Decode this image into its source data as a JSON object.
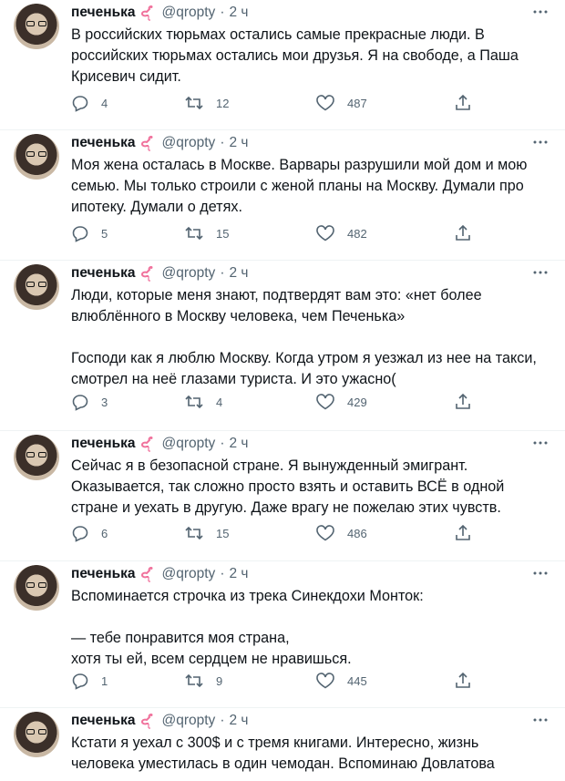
{
  "tweets": [
    {
      "author": "печенька",
      "handle": "@qropty",
      "time": "2 ч",
      "text": "В российских тюрьмах остались самые прекрасные люди. В российских тюрьмах остались мои друзья. Я на свободе, а Паша Крисевич сидит.",
      "replies": "4",
      "retweets": "12",
      "likes": "487"
    },
    {
      "author": "печенька",
      "handle": "@qropty",
      "time": "2 ч",
      "text": "Моя жена осталась в Москве. Варвары разрушили мой дом и мою семью. Мы только строили с женой планы на Москву. Думали про ипотеку. Думали о детях.",
      "replies": "5",
      "retweets": "15",
      "likes": "482"
    },
    {
      "author": "печенька",
      "handle": "@qropty",
      "time": "2 ч",
      "text": "Люди, которые меня знают, подтвердят вам это: «нет более влюблённого в Москву человека, чем Печенька»\n\nГосподи как я люблю Москву. Когда утром я уезжал из нее на такси, смотрел на неё глазами туриста. И это ужасно(",
      "replies": "3",
      "retweets": "4",
      "likes": "429"
    },
    {
      "author": "печенька",
      "handle": "@qropty",
      "time": "2 ч",
      "text": "Сейчас я в безопасной стране. Я вынужденный эмигрант. Оказывается, так сложно просто взять и оставить ВСЁ в одной стране и уехать в другую. Даже врагу не пожелаю этих чувств.",
      "replies": "6",
      "retweets": "15",
      "likes": "486"
    },
    {
      "author": "печенька",
      "handle": "@qropty",
      "time": "2 ч",
      "text": "Вспоминается строчка из трека Синекдохи Монток:\n\n— тебе понравится моя страна,\nхотя ты ей, всем сердцем не нравишься.",
      "replies": "1",
      "retweets": "9",
      "likes": "445"
    },
    {
      "author": "печенька",
      "handle": "@qropty",
      "time": "2 ч",
      "text": "Кстати я уехал с 300$ и с тремя книгами. Интересно, жизнь человека уместилась в один чемодан. Вспоминаю Довлатова",
      "replies": "",
      "retweets": "",
      "likes": ""
    }
  ],
  "icons": {
    "reply": "reply-icon",
    "retweet": "retweet-icon",
    "like": "heart-icon",
    "share": "share-icon",
    "more": "more-dots-icon",
    "emoji": "flamingo-icon"
  },
  "colors": {
    "secondary_text": "#536471",
    "primary_text": "#0f1419",
    "divider": "#eff3f4"
  }
}
